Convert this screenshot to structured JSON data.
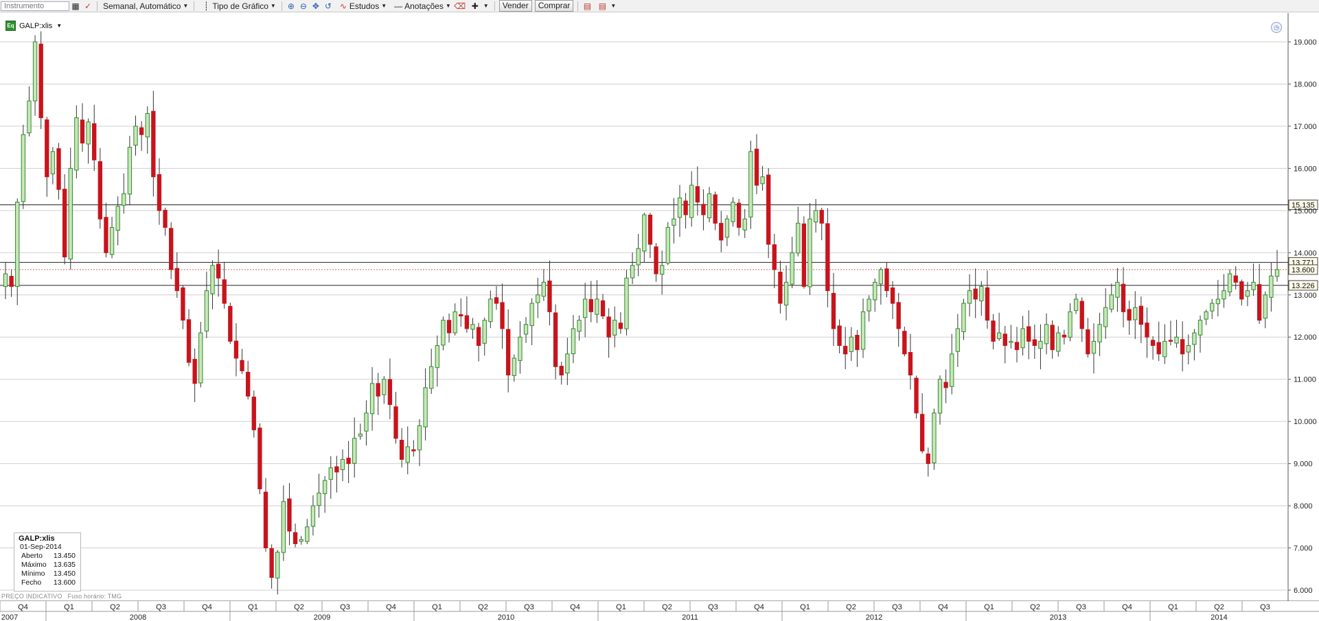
{
  "toolbar": {
    "instrument_placeholder": "Instrumento",
    "period_label": "Semanal, Automático",
    "chart_type_label": "Tipo de Gráfico",
    "studies_label": "Estudos",
    "annotations_label": "Anotações",
    "sell_label": "Vender",
    "buy_label": "Comprar",
    "icons": [
      "calendar-icon",
      "indicator-icon",
      "zoom-in-icon",
      "zoom-out-icon",
      "pan-icon",
      "undo-icon",
      "studies-icon",
      "line-icon",
      "eraser-icon",
      "crosshair-icon",
      "chart-icon",
      "compare-icon"
    ]
  },
  "instrument": {
    "symbol": "GALP:xlis",
    "icon": "eq-icon"
  },
  "legend": {
    "title": "GALP:xlis",
    "date": "01-Sep-2014",
    "rows": [
      {
        "label": "Aberto",
        "value": "13.450"
      },
      {
        "label": "Máximo",
        "value": "13.635"
      },
      {
        "label": "Mínimo",
        "value": "13.450"
      },
      {
        "label": "Fecho",
        "value": "13.600"
      }
    ]
  },
  "footer_note": {
    "text": "PREÇO INDICATIVO",
    "timezone": "Fuso horário: TMG"
  },
  "colors": {
    "up": "#2f8a2f",
    "up_fill": "#c9e6b8",
    "down": "#c8141c",
    "grid": "#cfcfcf",
    "hline": "#222222",
    "current": "#cc6666"
  },
  "chart_data": {
    "type": "candlestick",
    "interval": "weekly",
    "ylim": [
      6.0,
      19.0
    ],
    "y_ticks": [
      "19.000",
      "18.000",
      "17.000",
      "16.000",
      "15.000",
      "14.000",
      "13.000",
      "12.000",
      "11.000",
      "10.000",
      "9.000",
      "8.000",
      "7.000",
      "6.000"
    ],
    "quarters": [
      "Q4",
      "Q1",
      "Q2",
      "Q3",
      "Q4",
      "Q1",
      "Q2",
      "Q3",
      "Q4",
      "Q1",
      "Q2",
      "Q3",
      "Q4",
      "Q1",
      "Q2",
      "Q3",
      "Q4",
      "Q1",
      "Q2",
      "Q3",
      "Q4",
      "Q1",
      "Q2",
      "Q3",
      "Q4",
      "Q1",
      "Q2",
      "Q3"
    ],
    "years": [
      "2007",
      "2008",
      "2009",
      "2010",
      "2011",
      "2012",
      "2013",
      "2014"
    ],
    "horizontal_lines": [
      {
        "value": 15.135,
        "label": "15.135"
      },
      {
        "value": 13.771,
        "label": "13.771"
      },
      {
        "value": 13.226,
        "label": "13.226"
      }
    ],
    "current": {
      "value": 13.6,
      "label": "13.600"
    },
    "closes": [
      13.5,
      13.2,
      15.2,
      16.8,
      17.6,
      19.0,
      17.2,
      15.8,
      16.4,
      15.5,
      13.9,
      16.0,
      17.2,
      16.6,
      17.1,
      16.2,
      14.8,
      14.0,
      14.6,
      15.1,
      15.4,
      16.5,
      17.0,
      16.8,
      17.3,
      15.8,
      15.0,
      14.6,
      13.6,
      13.1,
      12.4,
      11.4,
      10.9,
      12.1,
      13.1,
      13.7,
      13.4,
      12.8,
      11.9,
      11.5,
      11.2,
      10.6,
      9.8,
      8.4,
      7.0,
      6.3,
      6.9,
      8.1,
      7.4,
      7.1,
      7.2,
      7.5,
      8.0,
      8.3,
      8.6,
      8.9,
      8.8,
      9.1,
      9.0,
      9.6,
      9.7,
      10.2,
      10.9,
      10.6,
      11.0,
      10.4,
      9.6,
      9.1,
      9.4,
      9.3,
      9.9,
      10.8,
      11.3,
      11.8,
      12.4,
      12.1,
      12.6,
      12.5,
      12.2,
      12.3,
      11.8,
      12.4,
      12.9,
      12.8,
      12.2,
      11.1,
      11.5,
      12.0,
      12.3,
      12.8,
      13.0,
      13.3,
      12.6,
      11.3,
      11.1,
      11.6,
      12.2,
      12.4,
      12.9,
      12.6,
      12.9,
      12.5,
      12.0,
      12.4,
      12.2,
      13.4,
      13.7,
      14.1,
      14.9,
      14.2,
      13.5,
      13.7,
      14.6,
      14.8,
      15.3,
      14.9,
      15.6,
      15.2,
      14.9,
      15.4,
      14.7,
      14.3,
      14.8,
      15.2,
      14.6,
      14.8,
      16.4,
      15.6,
      15.8,
      14.2,
      13.6,
      12.8,
      13.3,
      14.0,
      14.7,
      13.2,
      14.8,
      15.0,
      14.7,
      13.1,
      12.2,
      11.8,
      11.6,
      12.0,
      11.7,
      12.6,
      12.9,
      13.3,
      13.6,
      13.1,
      12.8,
      12.2,
      11.6,
      11.1,
      10.2,
      9.3,
      9.0,
      10.2,
      11.0,
      10.8,
      11.6,
      12.2,
      12.8,
      13.1,
      12.9,
      13.2,
      12.4,
      11.9,
      12.1,
      11.8,
      11.9,
      11.7,
      12.2,
      11.9,
      11.8,
      11.9,
      12.3,
      11.7,
      12.1,
      12.0,
      12.6,
      12.9,
      12.2,
      11.6,
      11.9,
      12.3,
      12.7,
      13.0,
      13.3,
      12.6,
      12.4,
      12.7,
      12.3,
      12.0,
      11.8,
      11.6,
      11.9,
      11.9,
      12.0,
      11.6,
      11.8,
      12.1,
      12.4,
      12.6,
      12.8,
      12.9,
      13.1,
      13.5,
      13.3,
      12.9,
      13.1,
      13.3,
      12.4,
      13.0,
      13.45,
      13.6
    ]
  }
}
